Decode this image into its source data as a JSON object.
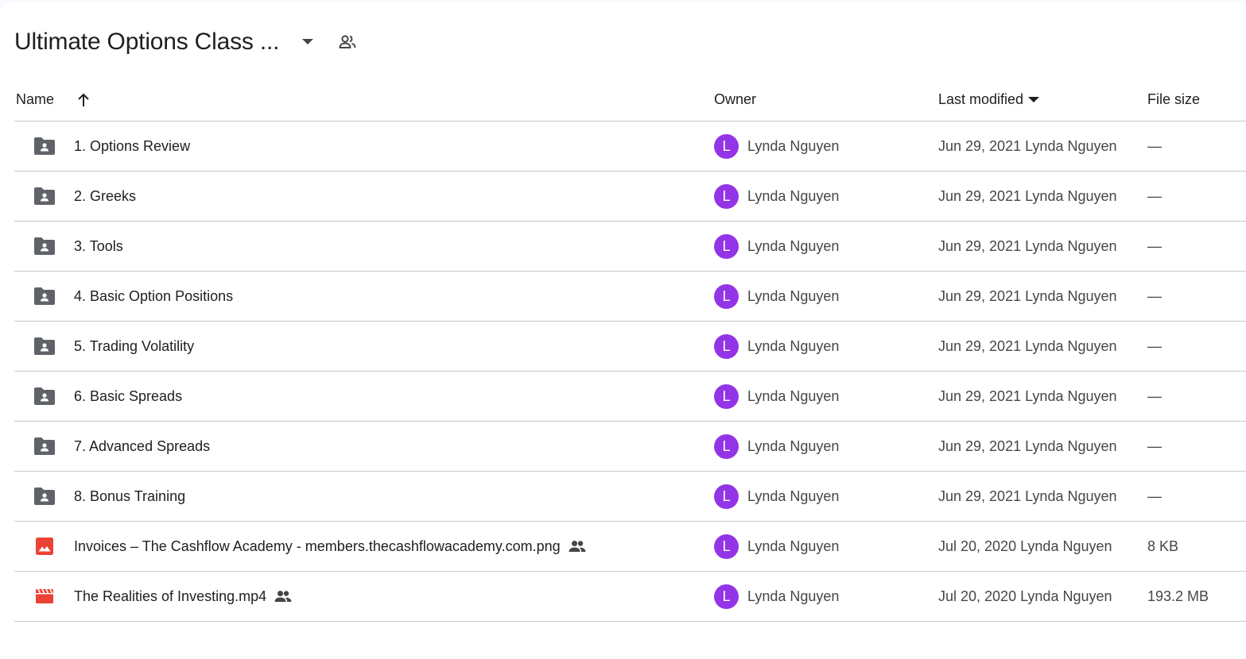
{
  "folder": {
    "title": "Ultimate Options Class ..."
  },
  "columns": {
    "name": "Name",
    "owner": "Owner",
    "last_modified": "Last modified",
    "file_size": "File size"
  },
  "rows": [
    {
      "name": "1. Options Review",
      "type": "shared-folder",
      "owner": "Lynda Nguyen",
      "owner_initial": "L",
      "modified": "Jun 29, 2021 Lynda Nguyen",
      "size": "—",
      "shared": false
    },
    {
      "name": "2. Greeks",
      "type": "shared-folder",
      "owner": "Lynda Nguyen",
      "owner_initial": "L",
      "modified": "Jun 29, 2021 Lynda Nguyen",
      "size": "—",
      "shared": false
    },
    {
      "name": "3. Tools",
      "type": "shared-folder",
      "owner": "Lynda Nguyen",
      "owner_initial": "L",
      "modified": "Jun 29, 2021 Lynda Nguyen",
      "size": "—",
      "shared": false
    },
    {
      "name": "4. Basic Option Positions",
      "type": "shared-folder",
      "owner": "Lynda Nguyen",
      "owner_initial": "L",
      "modified": "Jun 29, 2021 Lynda Nguyen",
      "size": "—",
      "shared": false
    },
    {
      "name": "5. Trading Volatility",
      "type": "shared-folder",
      "owner": "Lynda Nguyen",
      "owner_initial": "L",
      "modified": "Jun 29, 2021 Lynda Nguyen",
      "size": "—",
      "shared": false
    },
    {
      "name": "6. Basic Spreads",
      "type": "shared-folder",
      "owner": "Lynda Nguyen",
      "owner_initial": "L",
      "modified": "Jun 29, 2021 Lynda Nguyen",
      "size": "—",
      "shared": false
    },
    {
      "name": "7. Advanced Spreads",
      "type": "shared-folder",
      "owner": "Lynda Nguyen",
      "owner_initial": "L",
      "modified": "Jun 29, 2021 Lynda Nguyen",
      "size": "—",
      "shared": false
    },
    {
      "name": "8. Bonus Training",
      "type": "shared-folder",
      "owner": "Lynda Nguyen",
      "owner_initial": "L",
      "modified": "Jun 29, 2021 Lynda Nguyen",
      "size": "—",
      "shared": false
    },
    {
      "name": "Invoices – The Cashflow Academy - members.thecashflowacademy.com.png",
      "type": "image",
      "owner": "Lynda Nguyen",
      "owner_initial": "L",
      "modified": "Jul 20, 2020 Lynda Nguyen",
      "size": "8 KB",
      "shared": true
    },
    {
      "name": "The Realities of Investing.mp4",
      "type": "video",
      "owner": "Lynda Nguyen",
      "owner_initial": "L",
      "modified": "Jul 20, 2020 Lynda Nguyen",
      "size": "193.2 MB",
      "shared": true
    }
  ],
  "colors": {
    "avatar": "#9334e6",
    "folder_icon": "#5f6368",
    "file_icon_red": "#ea4335",
    "divider": "#c7c7c7"
  }
}
